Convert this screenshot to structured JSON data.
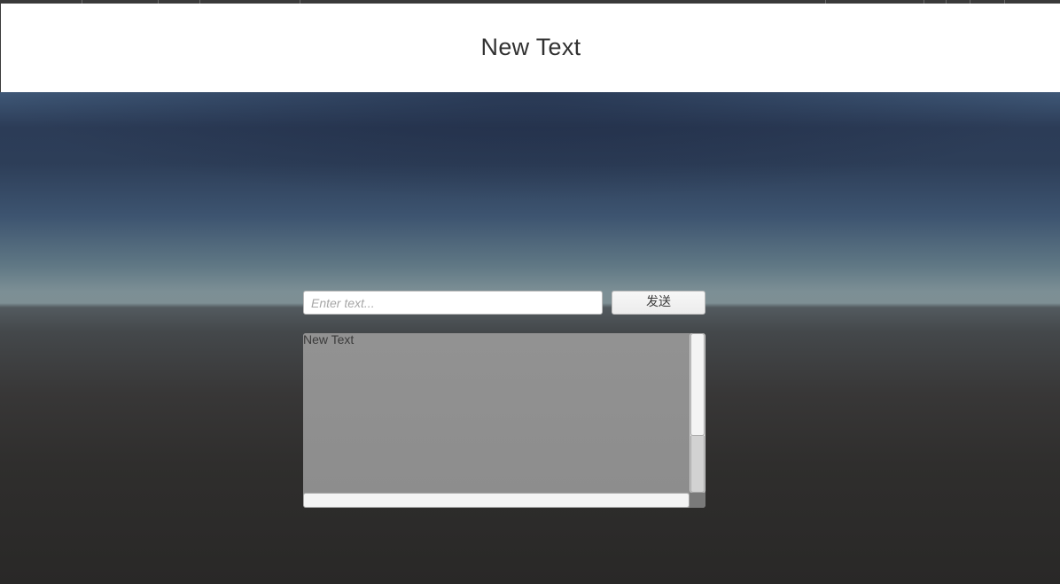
{
  "header": {
    "title": "New Text"
  },
  "chat": {
    "input_value": "",
    "input_placeholder": "Enter text...",
    "send_label": "发送",
    "log_text": "New Text"
  },
  "colors": {
    "header_bg": "#ffffff",
    "sky_top": "#2c3c57",
    "horizon": "#7c8f95",
    "ground": "#292827",
    "scroll_view_bg": "#8e8e8e"
  }
}
